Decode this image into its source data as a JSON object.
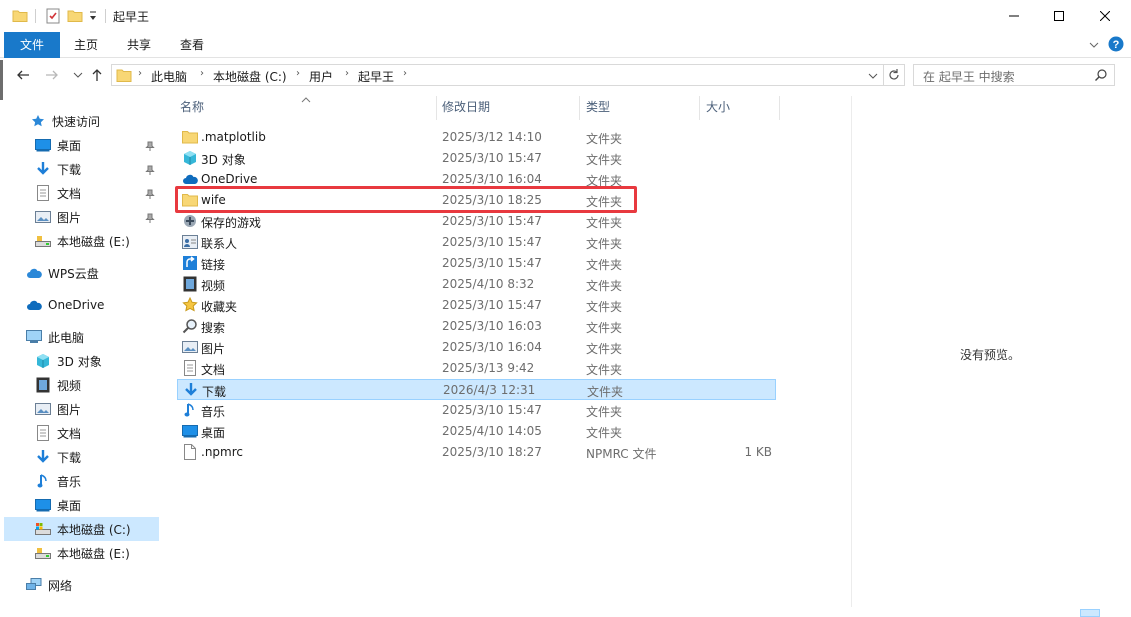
{
  "window": {
    "title": "起早王",
    "controls": [
      "minimize",
      "maximize",
      "close"
    ]
  },
  "ribbon": {
    "tabs": [
      "文件",
      "主页",
      "共享",
      "查看"
    ]
  },
  "address": {
    "crumbs": [
      "此电脑",
      "本地磁盘 (C:)",
      "用户",
      "起早王"
    ]
  },
  "search": {
    "placeholder": "在 起早王 中搜索"
  },
  "nav": {
    "quick_access": "快速访问",
    "quick_items": [
      "桌面",
      "下载",
      "文档",
      "图片",
      "本地磁盘 (E:)"
    ],
    "wps": "WPS云盘",
    "onedrive": "OneDrive",
    "this_pc": "此电脑",
    "pc_items": [
      "3D 对象",
      "视频",
      "图片",
      "文档",
      "下载",
      "音乐",
      "桌面",
      "本地磁盘 (C:)",
      "本地磁盘 (E:)"
    ],
    "network": "网络"
  },
  "columns": {
    "name": "名称",
    "date": "修改日期",
    "type": "类型",
    "size": "大小"
  },
  "files": [
    {
      "name": ".matplotlib",
      "date": "2025/3/12 14:10",
      "type": "文件夹",
      "size": "",
      "icon": "folder-icon"
    },
    {
      "name": "3D 对象",
      "date": "2025/3/10 15:47",
      "type": "文件夹",
      "size": "",
      "icon": "3d-objects-icon"
    },
    {
      "name": "OneDrive",
      "date": "2025/3/10 16:04",
      "type": "文件夹",
      "size": "",
      "icon": "onedrive-icon"
    },
    {
      "name": "wife",
      "date": "2025/3/10 18:25",
      "type": "文件夹",
      "size": "",
      "icon": "folder-icon"
    },
    {
      "name": "保存的游戏",
      "date": "2025/3/10 15:47",
      "type": "文件夹",
      "size": "",
      "icon": "saved-games-icon"
    },
    {
      "name": "联系人",
      "date": "2025/3/10 15:47",
      "type": "文件夹",
      "size": "",
      "icon": "contacts-icon"
    },
    {
      "name": "链接",
      "date": "2025/3/10 15:47",
      "type": "文件夹",
      "size": "",
      "icon": "links-icon"
    },
    {
      "name": "视频",
      "date": "2025/4/10 8:32",
      "type": "文件夹",
      "size": "",
      "icon": "videos-icon"
    },
    {
      "name": "收藏夹",
      "date": "2025/3/10 15:47",
      "type": "文件夹",
      "size": "",
      "icon": "favorites-icon"
    },
    {
      "name": "搜索",
      "date": "2025/3/10 16:03",
      "type": "文件夹",
      "size": "",
      "icon": "searches-icon"
    },
    {
      "name": "图片",
      "date": "2025/3/10 16:04",
      "type": "文件夹",
      "size": "",
      "icon": "pictures-icon"
    },
    {
      "name": "文档",
      "date": "2025/3/13 9:42",
      "type": "文件夹",
      "size": "",
      "icon": "documents-icon"
    },
    {
      "name": "下载",
      "date": "2026/4/3 12:31",
      "type": "文件夹",
      "size": "",
      "icon": "downloads-icon"
    },
    {
      "name": "音乐",
      "date": "2025/3/10 15:47",
      "type": "文件夹",
      "size": "",
      "icon": "music-icon"
    },
    {
      "name": "桌面",
      "date": "2025/4/10 14:05",
      "type": "文件夹",
      "size": "",
      "icon": "desktop-icon"
    },
    {
      "name": ".npmrc",
      "date": "2025/3/10 18:27",
      "type": "NPMRC 文件",
      "size": "1 KB",
      "icon": "file-icon"
    }
  ],
  "selected_file": "下载",
  "highlighted_file": "wife",
  "preview": {
    "text": "没有预览。"
  },
  "colors": {
    "accent": "#1979ca",
    "selection": "#cce8ff",
    "highlight_box": "#e8393f"
  }
}
